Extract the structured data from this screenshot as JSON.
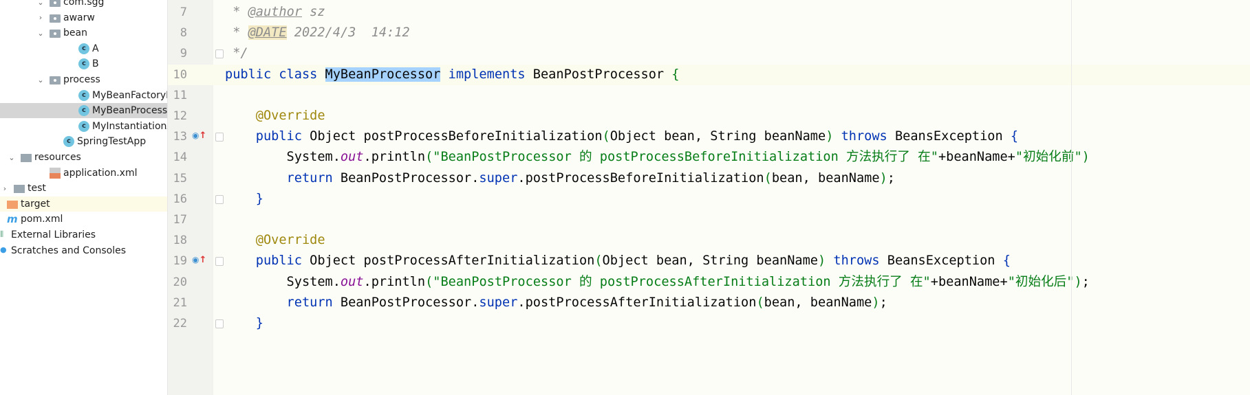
{
  "project_tree": [
    {
      "label": "com.sgg",
      "icon": "package-icon",
      "indent": 72,
      "chevron": "down"
    },
    {
      "label": "awarw",
      "icon": "package-icon",
      "indent": 72,
      "chevron": "right"
    },
    {
      "label": "bean",
      "icon": "package-icon",
      "indent": 72,
      "chevron": "down"
    },
    {
      "label": "A",
      "icon": "class-icon",
      "indent": 114
    },
    {
      "label": "B",
      "icon": "class-icon",
      "indent": 114
    },
    {
      "label": "process",
      "icon": "package-icon",
      "indent": 72,
      "chevron": "down"
    },
    {
      "label": "MyBeanFactoryPr",
      "icon": "class-icon",
      "indent": 114
    },
    {
      "label": "MyBeanProcessor",
      "icon": "class-icon",
      "indent": 114,
      "selected": true
    },
    {
      "label": "MyInstantiationAv",
      "icon": "class-icon",
      "indent": 114
    },
    {
      "label": "SpringTestApp",
      "icon": "runnable-class-icon",
      "indent": 92
    },
    {
      "label": "resources",
      "icon": "resources-folder-icon",
      "indent": 30,
      "chevron": "down"
    },
    {
      "label": "application.xml",
      "icon": "spring-xml-icon",
      "indent": 72
    },
    {
      "label": "test",
      "icon": "folder-icon",
      "indent": 10,
      "chevron": "right"
    },
    {
      "label": "target",
      "icon": "excluded-folder-icon",
      "indent": 10,
      "highlighted": true
    },
    {
      "label": "pom.xml",
      "icon": "maven-icon",
      "indent": 10
    },
    {
      "label": "External Libraries",
      "icon": "library-icon",
      "indent": -4
    },
    {
      "label": "Scratches and Consoles",
      "icon": "scratches-icon",
      "indent": -4
    }
  ],
  "editor": {
    "current_line": 10,
    "lines": [
      {
        "n": "7",
        "t": [
          [
            " * ",
            "cm"
          ],
          [
            "@author",
            "tag"
          ],
          [
            " sz",
            "cm"
          ]
        ]
      },
      {
        "n": "8",
        "t": [
          [
            " * ",
            "cm"
          ],
          [
            "@DATE",
            "tag tagbg"
          ],
          [
            " 2022/4/3  14:12",
            "cm"
          ]
        ]
      },
      {
        "n": "9",
        "t": [
          [
            " */",
            "cm"
          ]
        ],
        "fold": true
      },
      {
        "n": "10",
        "t": [
          [
            "public class ",
            "kw"
          ],
          [
            "MyBeanProcessor",
            "pl sel"
          ],
          [
            " implements ",
            "kw"
          ],
          [
            "BeanPostProcessor ",
            "pl"
          ],
          [
            "{",
            "br"
          ]
        ]
      },
      {
        "n": "11",
        "t": []
      },
      {
        "n": "12",
        "t": [
          [
            "    @Override",
            "an"
          ]
        ]
      },
      {
        "n": "13",
        "t": [
          [
            "    public ",
            "kw"
          ],
          [
            "Object postProcessBeforeInitialization",
            "pl"
          ],
          [
            "(",
            "br"
          ],
          [
            "Object bean, String beanName",
            "pl"
          ],
          [
            ")",
            "br"
          ],
          [
            " throws ",
            "kw"
          ],
          [
            "BeansException ",
            "pl"
          ],
          [
            "{",
            "kw"
          ]
        ],
        "override": true,
        "fold": true
      },
      {
        "n": "14",
        "t": [
          [
            "        System.",
            "pl"
          ],
          [
            "out",
            "fld"
          ],
          [
            ".println",
            "pl"
          ],
          [
            "(",
            "br"
          ],
          [
            "\"BeanPostProcessor 的 postProcessBeforeInitialization 方法执行了 在\"",
            "str"
          ],
          [
            "+beanName+",
            "pl"
          ],
          [
            "\"初始化前\"",
            "str"
          ],
          [
            ")",
            "br"
          ]
        ]
      },
      {
        "n": "15",
        "t": [
          [
            "        return ",
            "kw"
          ],
          [
            "BeanPostProcessor.",
            "pl"
          ],
          [
            "super",
            "kw"
          ],
          [
            ".postProcessBeforeInitialization",
            "pl"
          ],
          [
            "(",
            "br"
          ],
          [
            "bean, beanName",
            "pl"
          ],
          [
            ")",
            "br"
          ],
          [
            ";",
            "pl"
          ]
        ]
      },
      {
        "n": "16",
        "t": [
          [
            "    }",
            "kw"
          ]
        ],
        "fold": true
      },
      {
        "n": "17",
        "t": []
      },
      {
        "n": "18",
        "t": [
          [
            "    @Override",
            "an"
          ]
        ]
      },
      {
        "n": "19",
        "t": [
          [
            "    public ",
            "kw"
          ],
          [
            "Object postProcessAfterInitialization",
            "pl"
          ],
          [
            "(",
            "br"
          ],
          [
            "Object bean, String beanName",
            "pl"
          ],
          [
            ")",
            "br"
          ],
          [
            " throws ",
            "kw"
          ],
          [
            "BeansException ",
            "pl"
          ],
          [
            "{",
            "kw"
          ]
        ],
        "override": true,
        "fold": true
      },
      {
        "n": "20",
        "t": [
          [
            "        System.",
            "pl"
          ],
          [
            "out",
            "fld"
          ],
          [
            ".println",
            "pl"
          ],
          [
            "(",
            "br"
          ],
          [
            "\"BeanPostProcessor 的 postProcessAfterInitialization 方法执行了 在\"",
            "str"
          ],
          [
            "+beanName+",
            "pl"
          ],
          [
            "\"初始化后\"",
            "str"
          ],
          [
            ")",
            "br"
          ],
          [
            ";",
            "pl"
          ]
        ]
      },
      {
        "n": "21",
        "t": [
          [
            "        return ",
            "kw"
          ],
          [
            "BeanPostProcessor.",
            "pl"
          ],
          [
            "super",
            "kw"
          ],
          [
            ".postProcessAfterInitialization",
            "pl"
          ],
          [
            "(",
            "br"
          ],
          [
            "bean, beanName",
            "pl"
          ],
          [
            ")",
            "br"
          ],
          [
            ";",
            "pl"
          ]
        ]
      },
      {
        "n": "22",
        "t": [
          [
            "    }",
            "kw"
          ]
        ],
        "fold": true
      }
    ]
  }
}
